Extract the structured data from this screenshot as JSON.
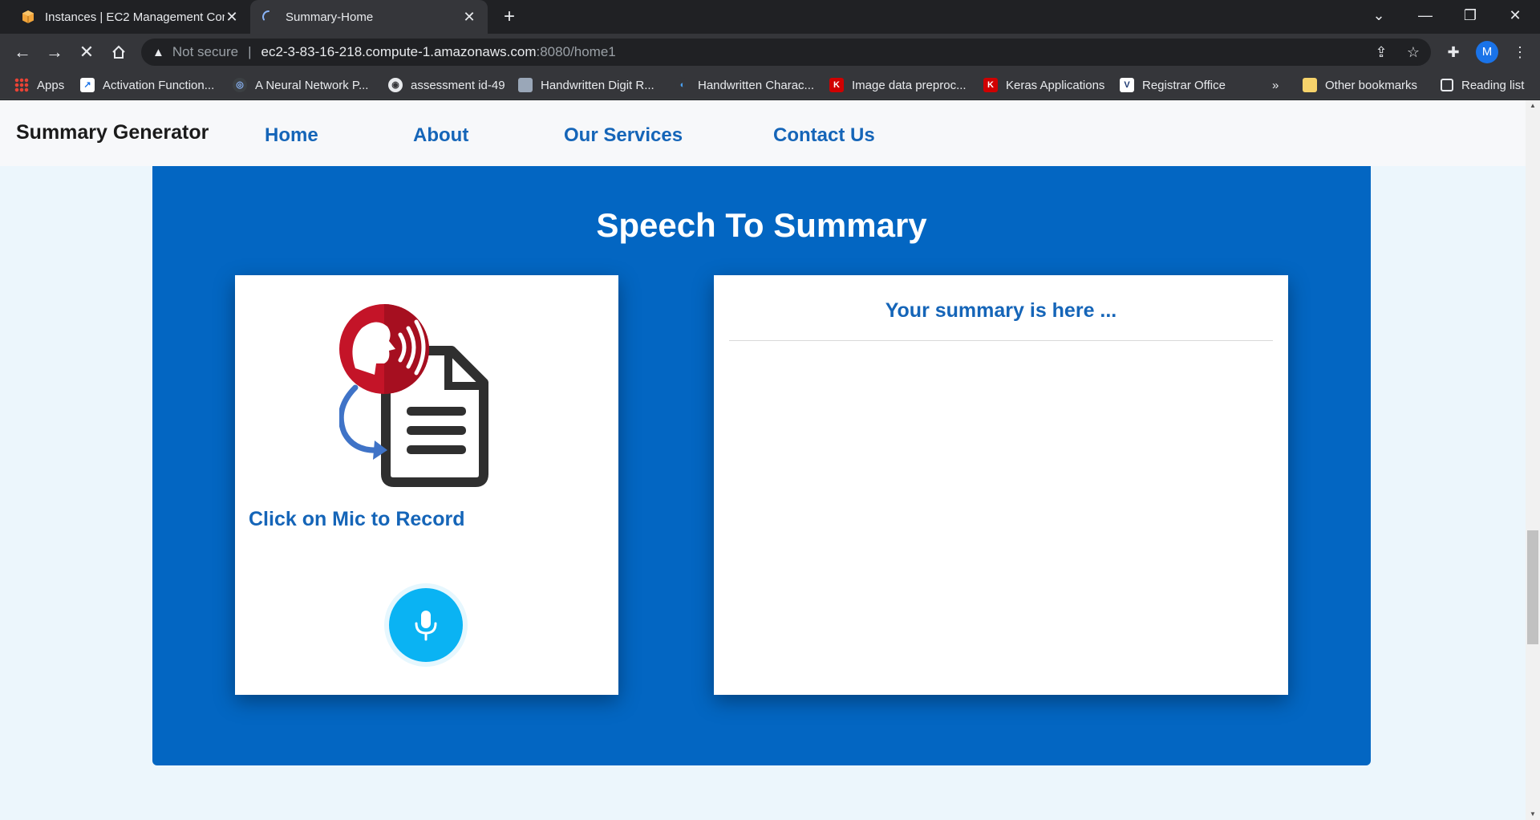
{
  "browser": {
    "tabs": [
      {
        "title": "Instances | EC2 Management Con",
        "active": false,
        "icon": "aws-box-icon"
      },
      {
        "title": "Summary-Home",
        "active": true,
        "icon": "loading-spinner-icon"
      }
    ],
    "address": {
      "security_label": "Not secure",
      "host": "ec2-3-83-16-218.compute-1.amazonaws.com",
      "path": ":8080/home1"
    },
    "profile_initial": "M",
    "bookmarks": [
      {
        "label": "Apps"
      },
      {
        "label": "Activation Function..."
      },
      {
        "label": "A Neural Network P..."
      },
      {
        "label": "assessment id-49"
      },
      {
        "label": "Handwritten Digit R..."
      },
      {
        "label": "Handwritten Charac..."
      },
      {
        "label": "Image data preproc..."
      },
      {
        "label": "Keras Applications"
      },
      {
        "label": "Registrar Office"
      }
    ],
    "overflow_chevron": "»",
    "other_bookmarks": "Other bookmarks",
    "reading_list": "Reading list"
  },
  "site": {
    "brand": "Summary Generator",
    "nav": [
      {
        "label": "Home"
      },
      {
        "label": "About"
      },
      {
        "label": "Our Services"
      },
      {
        "label": "Contact Us"
      }
    ],
    "hero_title": "Speech To Summary",
    "record_label": "Click on Mic to Record",
    "summary_heading": "Your summary is here ...",
    "summary_text": ""
  },
  "colors": {
    "hero_bg": "#0366c2",
    "link": "#1565b8",
    "mic": "#0ab3f3",
    "page_bg": "#ecf6fc"
  }
}
